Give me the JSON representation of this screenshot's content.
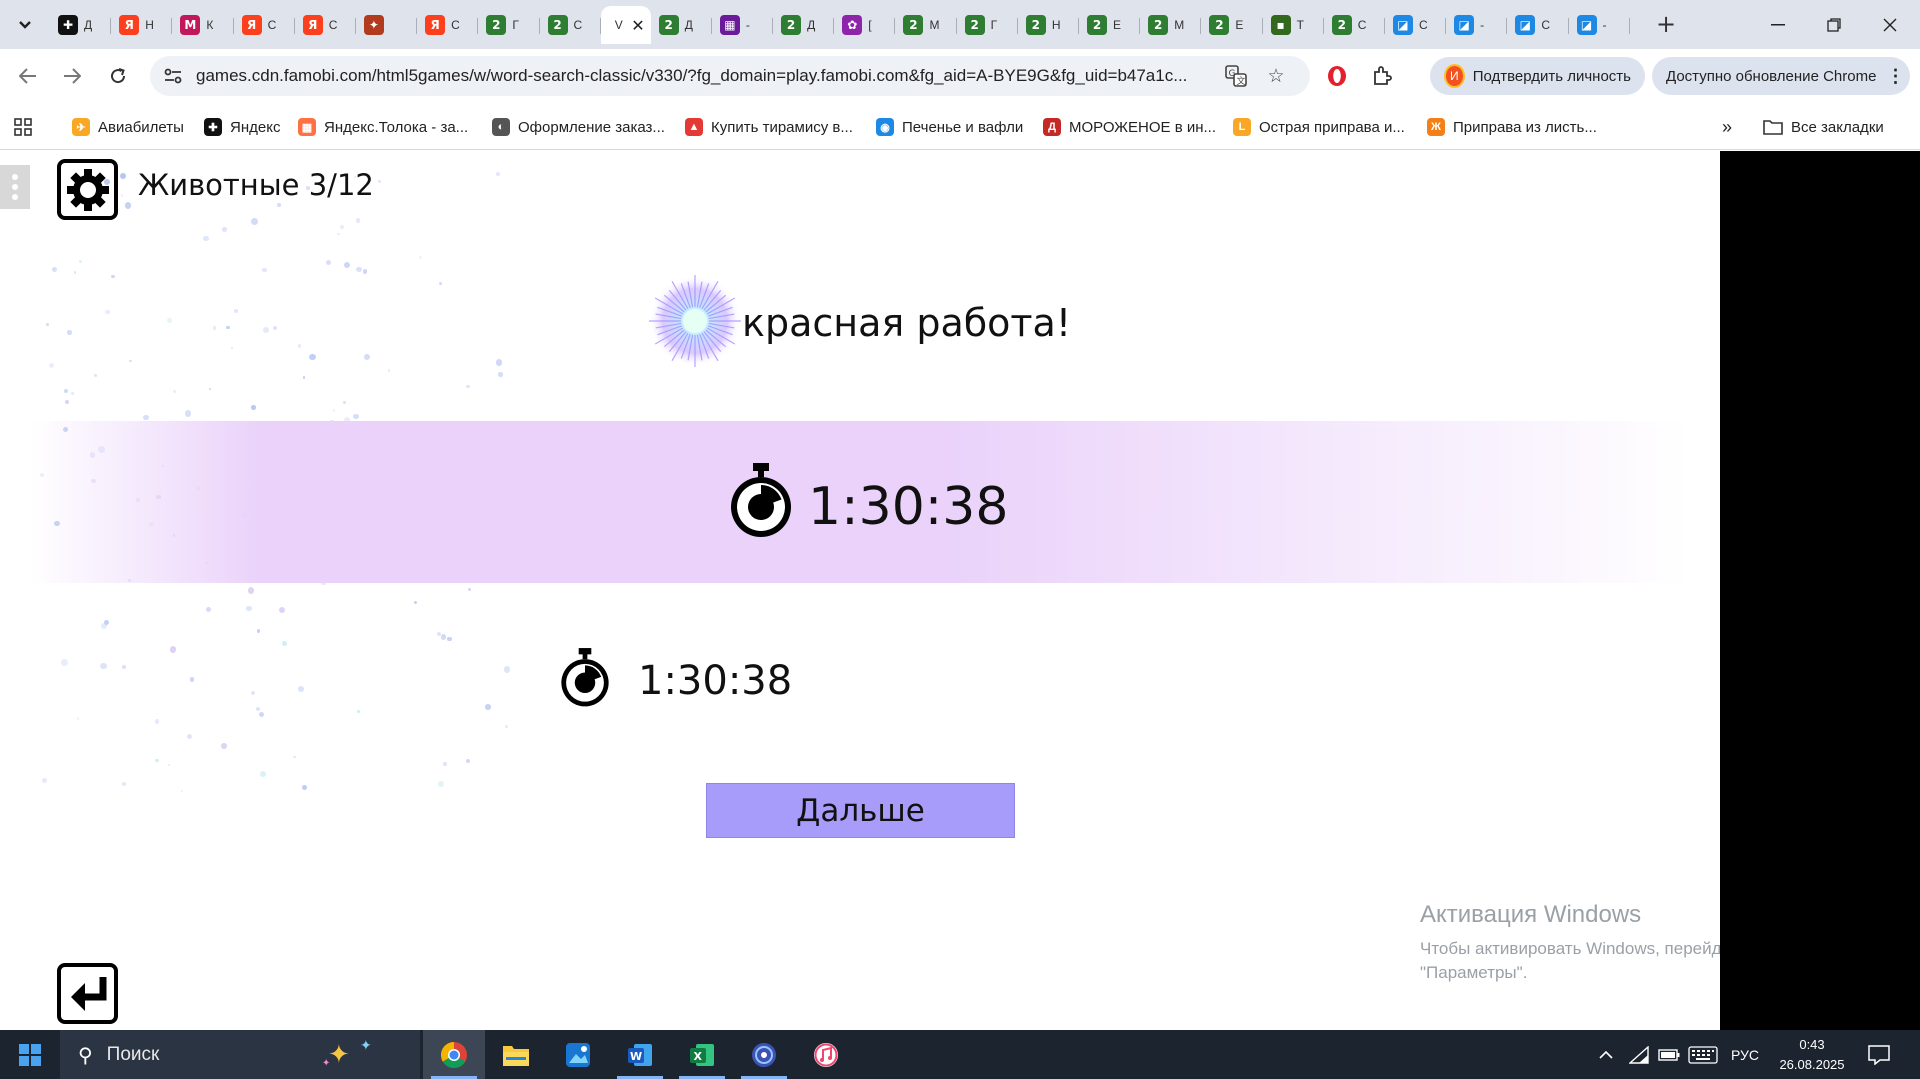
{
  "browser": {
    "tabs": [
      {
        "letter": "Д",
        "color": "#111111",
        "glyph": "✚"
      },
      {
        "letter": "Н",
        "color": "#fc3f1d",
        "glyph": "Я"
      },
      {
        "letter": "К",
        "color": "#c2185b",
        "glyph": "М"
      },
      {
        "letter": "С",
        "color": "#fc3f1d",
        "glyph": "Я"
      },
      {
        "letter": "С",
        "color": "#fc3f1d",
        "glyph": "Я"
      },
      {
        "letter": "",
        "color": "#b23b1e",
        "glyph": "✦"
      },
      {
        "letter": "С",
        "color": "#fc3f1d",
        "glyph": "Я"
      },
      {
        "letter": "Г",
        "color": "#2e7d32",
        "glyph": "2"
      },
      {
        "letter": "С",
        "color": "#2e7d32",
        "glyph": "2"
      },
      {
        "letter": "V",
        "color": "#ffffff",
        "glyph": "",
        "active": true
      },
      {
        "letter": "Д",
        "color": "#2e7d32",
        "glyph": "2"
      },
      {
        "letter": "-",
        "color": "#6a1b9a",
        "glyph": "▦"
      },
      {
        "letter": "Д",
        "color": "#2e7d32",
        "glyph": "2"
      },
      {
        "letter": "[",
        "color": "#8e24aa",
        "glyph": "✿"
      },
      {
        "letter": "М",
        "color": "#2e7d32",
        "glyph": "2"
      },
      {
        "letter": "Г",
        "color": "#2e7d32",
        "glyph": "2"
      },
      {
        "letter": "Н",
        "color": "#2e7d32",
        "glyph": "2"
      },
      {
        "letter": "Е",
        "color": "#2e7d32",
        "glyph": "2"
      },
      {
        "letter": "М",
        "color": "#2e7d32",
        "glyph": "2"
      },
      {
        "letter": "Е",
        "color": "#2e7d32",
        "glyph": "2"
      },
      {
        "letter": "Т",
        "color": "#33691e",
        "glyph": "▪"
      },
      {
        "letter": "С",
        "color": "#2e7d32",
        "glyph": "2"
      },
      {
        "letter": "С",
        "color": "#1e88e5",
        "glyph": "◪"
      },
      {
        "letter": "-",
        "color": "#1e88e5",
        "glyph": "◪"
      },
      {
        "letter": "С",
        "color": "#1e88e5",
        "glyph": "◪"
      },
      {
        "letter": "-",
        "color": "#1e88e5",
        "glyph": "◪"
      }
    ],
    "url": "games.cdn.famobi.com/html5games/w/word-search-classic/v330/?fg_domain=play.famobi.com&fg_aid=A-BYE9G&fg_uid=b47a1c...",
    "profile_label": "Подтвердить личность",
    "profile_initial": "И",
    "update_label": "Доступно обновление Chrome",
    "bookmarks": [
      {
        "label": "Авиабилеты",
        "color": "#f9a825",
        "glyph": "✈"
      },
      {
        "label": "Яндекс",
        "color": "#111111",
        "glyph": "✚"
      },
      {
        "label": "Яндекс.Толока - за...",
        "color": "#ff7043",
        "glyph": "▦"
      },
      {
        "label": "Оформление заказ...",
        "color": "#555555",
        "glyph": "◐"
      },
      {
        "label": "Купить тирамису в...",
        "color": "#e53935",
        "glyph": "▲"
      },
      {
        "label": "Печенье и вафли",
        "color": "#1e88e5",
        "glyph": "◉"
      },
      {
        "label": "МОРОЖЕНОЕ в ин...",
        "color": "#c62828",
        "glyph": "Д"
      },
      {
        "label": "Острая приправа и...",
        "color": "#f9a825",
        "glyph": "L"
      },
      {
        "label": "Приправа из листь...",
        "color": "#f57f17",
        "glyph": "Ж"
      }
    ],
    "all_bookmarks_label": "Все закладки"
  },
  "game": {
    "level_title": "Животные 3/12",
    "congrats_text": "красная работа!",
    "current_time": "1:30:38",
    "best_time": "1:30:38",
    "next_button": "Дальше",
    "band_color": "#ead2fa",
    "button_color": "#a89cfa"
  },
  "watermark": {
    "title": "Активация Windows",
    "line1": "Чтобы активировать Windows, перейдите в раздел",
    "line2": "\"Параметры\"."
  },
  "taskbar": {
    "search_label": "Поиск",
    "language": "РУС",
    "time": "0:43",
    "date": "26.08.2025"
  }
}
